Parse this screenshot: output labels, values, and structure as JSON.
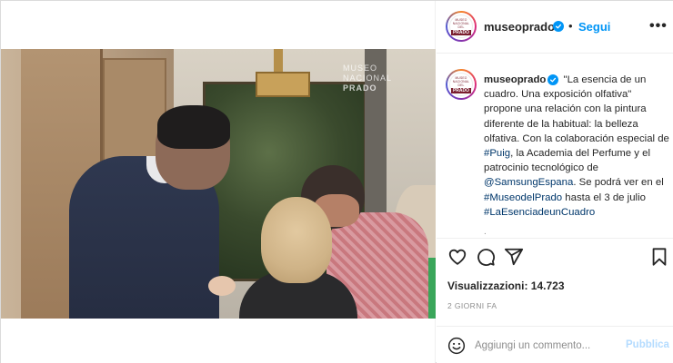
{
  "video": {
    "watermark_line1": "MUSEO NACIONAL",
    "watermark_line2": "PRADO"
  },
  "account": {
    "username": "museoprado",
    "follow_label": "Segui",
    "separator": "•",
    "more_label": "•••",
    "logo_line1": "MUSEO",
    "logo_line2": "NACIONAL",
    "logo_line3": "DEL",
    "logo_bold": "PRADO"
  },
  "caption": {
    "username": "museoprado",
    "text_1": "\"La esencia de un cuadro. Una exposición olfativa\" propone una relación con la pintura diferente de la habitual: la belleza olfativa. Con la colaboración especial de ",
    "tag_1": "#Puig",
    "text_2": ", la Academia del Perfume y el patrocinio tecnológico de ",
    "tag_2": "@SamsungEspana",
    "text_3": ". Se podrá ver en el ",
    "tag_3": "#MuseodelPrado",
    "text_4": " hasta el 3 de julio ",
    "tag_4": "#LaEsenciadeunCuadro",
    "more_dots": "."
  },
  "stats": {
    "views": "Visualizzazioni: 14.723",
    "time_ago": "2 GIORNI FA"
  },
  "comment": {
    "placeholder": "Aggiungi un commento...",
    "publish_label": "Pubblica"
  },
  "icons": {
    "like": "heart-icon",
    "comment": "comment-icon",
    "share": "share-icon",
    "save": "bookmark-icon",
    "emoji": "emoji-icon",
    "verified": "verified-badge-icon"
  },
  "colors": {
    "link_blue": "#0095f6",
    "tag_blue": "#00376b",
    "publish_disabled": "#b3dbff"
  }
}
